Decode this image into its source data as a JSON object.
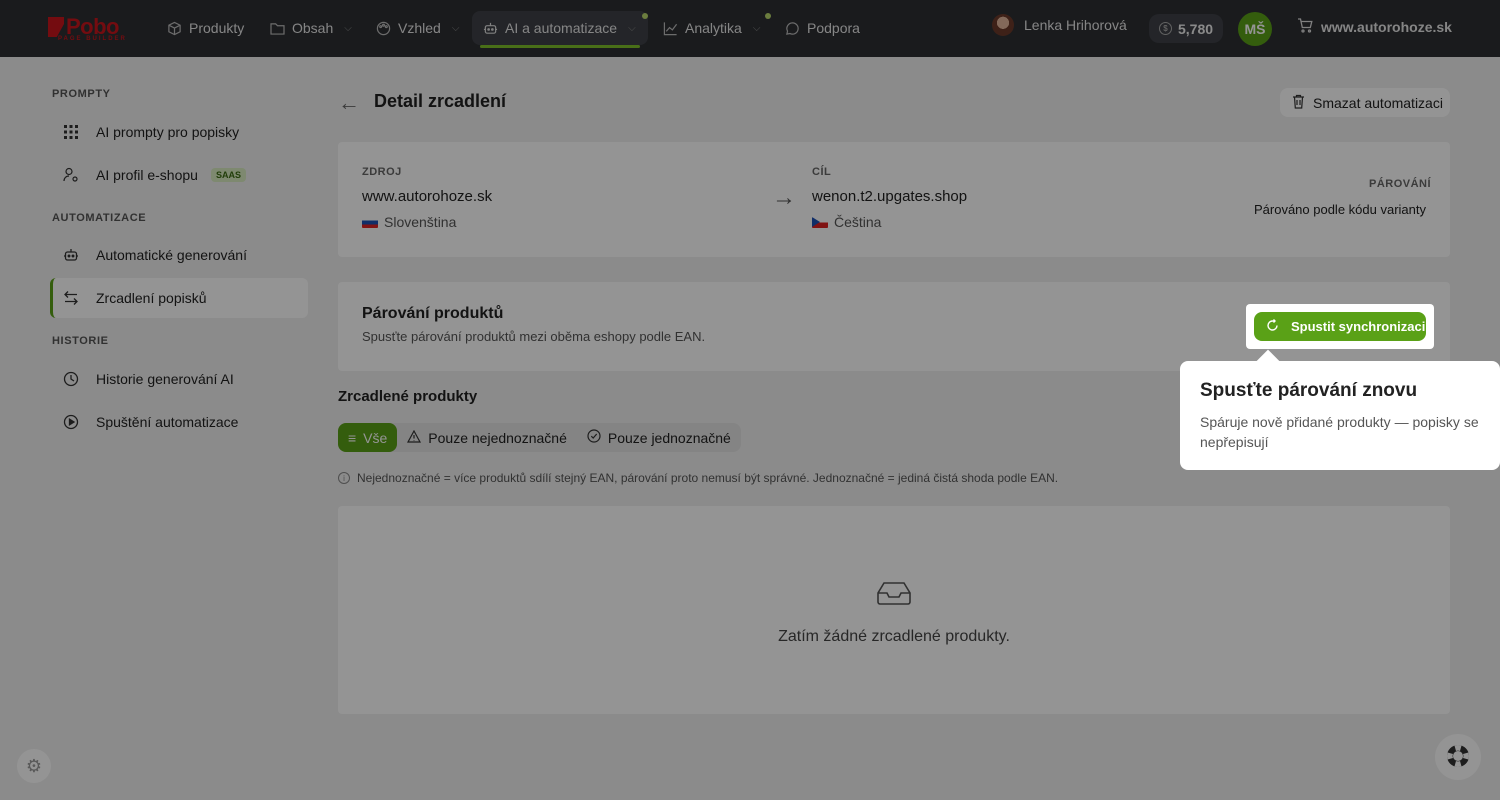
{
  "topbar": {
    "logo_text": "Pobo",
    "logo_sub": "PAGE BUILDER",
    "nav": [
      {
        "label": "Produkty",
        "icon": "box-icon"
      },
      {
        "label": "Obsah",
        "icon": "folder-icon"
      },
      {
        "label": "Vzhled",
        "icon": "palette-icon"
      },
      {
        "label": "AI a automatizace",
        "icon": "robot-icon",
        "active": true
      },
      {
        "label": "Analytika",
        "icon": "chart-icon"
      },
      {
        "label": "Podpora",
        "icon": "chat-icon"
      }
    ],
    "user_name": "Lenka Hrihorová",
    "credits": "5,780",
    "avatar_initials": "MŠ",
    "shop": "www.autorohoze.sk"
  },
  "sidebar": {
    "sections": [
      {
        "heading": "PROMPTY",
        "items": [
          {
            "label": "AI prompty pro popisky",
            "icon": "grid-icon"
          },
          {
            "label": "AI profil e-shopu",
            "icon": "user-settings-icon",
            "badge": "SAAS"
          }
        ]
      },
      {
        "heading": "AUTOMATIZACE",
        "items": [
          {
            "label": "Automatické generování",
            "icon": "robot-icon"
          },
          {
            "label": "Zrcadlení popisků",
            "icon": "swap-icon",
            "active": true
          }
        ]
      },
      {
        "heading": "HISTORIE",
        "items": [
          {
            "label": "Historie generování AI",
            "icon": "clock-icon"
          },
          {
            "label": "Spuštění automatizace",
            "icon": "play-icon"
          }
        ]
      }
    ]
  },
  "main": {
    "title": "Detail zrcadlení",
    "delete_label": "Smazat automatizaci",
    "source": {
      "label": "ZDROJ",
      "domain": "www.autorohoze.sk",
      "language": "Slovenština"
    },
    "target": {
      "label": "CÍL",
      "domain": "wenon.t2.upgates.shop",
      "language": "Čeština"
    },
    "pairing": {
      "label": "PÁROVÁNÍ",
      "value": "Párováno podle kódu varianty"
    },
    "product_pairing": {
      "title": "Párování produktů",
      "description": "Spusťte párování produktů mezi oběma eshopy podle EAN.",
      "button": "Spustit synchronizaci"
    },
    "mirrored": {
      "title": "Zrcadlené produkty",
      "filters": [
        "Vše",
        "Pouze nejednoznačné",
        "Pouze jednoznačné"
      ],
      "info": "Nejednoznačné = více produktů sdílí stejný EAN, párování proto nemusí být správné. Jednoznačné = jediná čistá shoda podle EAN.",
      "empty": "Zatím žádné zrcadlené produkty."
    }
  },
  "tooltip": {
    "title": "Spusťte párování znovu",
    "body": "Spáruje nově přidané produkty — popisky se nepřepisují"
  },
  "colors": {
    "accent": "#5aa117",
    "topbar": "#2d2f33",
    "brand": "#c8161d"
  }
}
